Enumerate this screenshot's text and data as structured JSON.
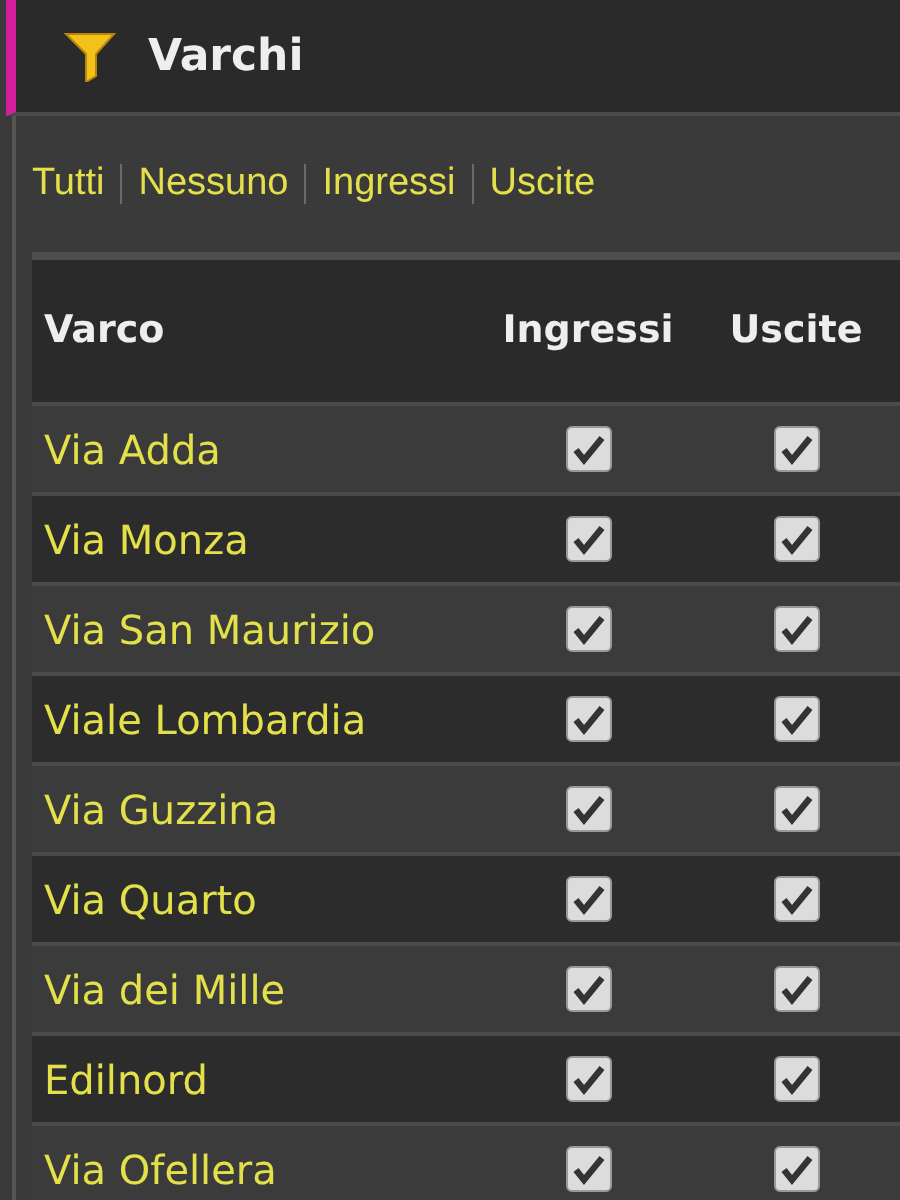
{
  "header": {
    "title": "Varchi"
  },
  "filters": [
    "Tutti",
    "Nessuno",
    "Ingressi",
    "Uscite"
  ],
  "table": {
    "columns": [
      "Varco",
      "Ingressi",
      "Uscite"
    ],
    "rows": [
      {
        "name": "Via Adda",
        "ingressi": true,
        "uscite": true
      },
      {
        "name": "Via Monza",
        "ingressi": true,
        "uscite": true
      },
      {
        "name": "Via San Maurizio",
        "ingressi": true,
        "uscite": true
      },
      {
        "name": "Viale Lombardia",
        "ingressi": true,
        "uscite": true
      },
      {
        "name": "Via Guzzina",
        "ingressi": true,
        "uscite": true
      },
      {
        "name": "Via Quarto",
        "ingressi": true,
        "uscite": true
      },
      {
        "name": "Via dei Mille",
        "ingressi": true,
        "uscite": true
      },
      {
        "name": "Edilnord",
        "ingressi": true,
        "uscite": true
      },
      {
        "name": "Via Ofellera",
        "ingressi": true,
        "uscite": true
      }
    ]
  }
}
